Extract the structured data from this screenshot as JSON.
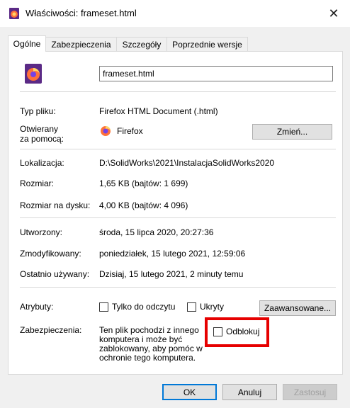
{
  "window": {
    "title": "Właściwości: frameset.html",
    "close_glyph": "✕"
  },
  "tabs": [
    {
      "label": "Ogólne",
      "active": true
    },
    {
      "label": "Zabezpieczenia",
      "active": false
    },
    {
      "label": "Szczegóły",
      "active": false
    },
    {
      "label": "Poprzednie wersje",
      "active": false
    }
  ],
  "general": {
    "filename": "frameset.html",
    "file_type_label": "Typ pliku:",
    "file_type_value": "Firefox HTML Document (.html)",
    "opens_with_label_1": "Otwierany",
    "opens_with_label_2": "za pomocą:",
    "opens_with_value": "Firefox",
    "change_button": "Zmień...",
    "location_label": "Lokalizacja:",
    "location_value": "D:\\SolidWorks\\2021\\InstalacjaSolidWorks2020",
    "size_label": "Rozmiar:",
    "size_value": "1,65 KB (bajtów: 1 699)",
    "size_on_disk_label": "Rozmiar na dysku:",
    "size_on_disk_value": "4,00 KB (bajtów: 4 096)",
    "created_label": "Utworzony:",
    "created_value": "środa, 15 lipca 2020, 20:27:36",
    "modified_label": "Zmodyfikowany:",
    "modified_value": "poniedziałek, 15 lutego 2021, 12:59:06",
    "accessed_label": "Ostatnio używany:",
    "accessed_value": "Dzisiaj, 15 lutego 2021, 2 minuty temu",
    "attributes_label": "Atrybuty:",
    "readonly_label": "Tylko do odczytu",
    "hidden_label": "Ukryty",
    "advanced_button": "Zaawansowane...",
    "security_label": "Zabezpieczenia:",
    "security_text_1": "Ten plik pochodzi z innego",
    "security_text_2": "komputera i może być",
    "security_text_3": "zablokowany, aby pomóc w",
    "security_text_4": "ochronie tego komputera.",
    "unblock_label": "Odblokuj"
  },
  "footer": {
    "ok": "OK",
    "cancel": "Anuluj",
    "apply": "Zastosuj"
  },
  "colors": {
    "highlight": "#e60000",
    "accent": "#0078d7",
    "firefox_orange": "#ff7139",
    "firefox_purple": "#7542e5"
  },
  "icons": {
    "title": "firefox-doc-icon",
    "file": "firefox-doc-icon",
    "app": "firefox-icon"
  }
}
